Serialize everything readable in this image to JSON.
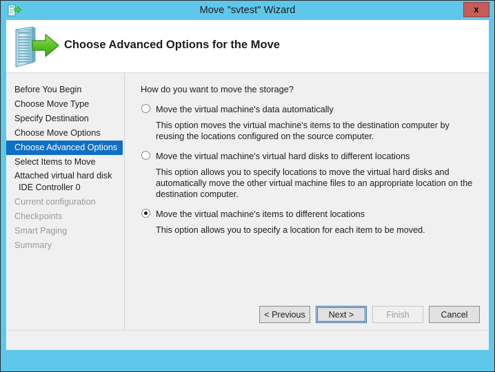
{
  "window": {
    "title": "Move \"svtest\" Wizard",
    "close_label": "x",
    "title_icon": "move-document-arrow-icon",
    "accent_color": "#5fc7ea",
    "highlight_color": "#0f6fc6"
  },
  "header": {
    "title": "Choose Advanced Options for the Move",
    "icon": "server-move-arrow-icon"
  },
  "sidebar": {
    "items": [
      {
        "label": "Before You Begin",
        "state": "normal"
      },
      {
        "label": "Choose Move Type",
        "state": "normal"
      },
      {
        "label": "Specify Destination",
        "state": "normal"
      },
      {
        "label": "Choose Move Options",
        "state": "normal"
      },
      {
        "label": "Choose Advanced Options",
        "state": "selected"
      },
      {
        "label": "Select Items to Move",
        "state": "normal"
      },
      {
        "label": "Attached virtual hard disk",
        "sub": "IDE Controller 0",
        "state": "normal"
      },
      {
        "label": "Current configuration",
        "state": "disabled"
      },
      {
        "label": "Checkpoints",
        "state": "disabled"
      },
      {
        "label": "Smart Paging",
        "state": "disabled"
      },
      {
        "label": "Summary",
        "state": "disabled"
      }
    ]
  },
  "content": {
    "question": "How do you want to move the storage?",
    "options": [
      {
        "label": "Move the virtual machine's data automatically",
        "description": "This option moves the virtual machine's items to the destination computer by reusing the locations configured on the source computer.",
        "selected": false
      },
      {
        "label": "Move the virtual machine's virtual hard disks to different locations",
        "description": "This option allows you to specify locations to move the virtual hard disks and automatically move the other virtual machine files to an appropriate location on the destination computer.",
        "selected": false
      },
      {
        "label": "Move the virtual machine's items to different locations",
        "description": "This option allows you to specify a location for each item to be moved.",
        "selected": true
      }
    ]
  },
  "footer": {
    "buttons": [
      {
        "label": "< Previous",
        "state": "normal"
      },
      {
        "label": "Next >",
        "state": "focused"
      },
      {
        "label": "Finish",
        "state": "disabled"
      },
      {
        "label": "Cancel",
        "state": "normal"
      }
    ]
  }
}
